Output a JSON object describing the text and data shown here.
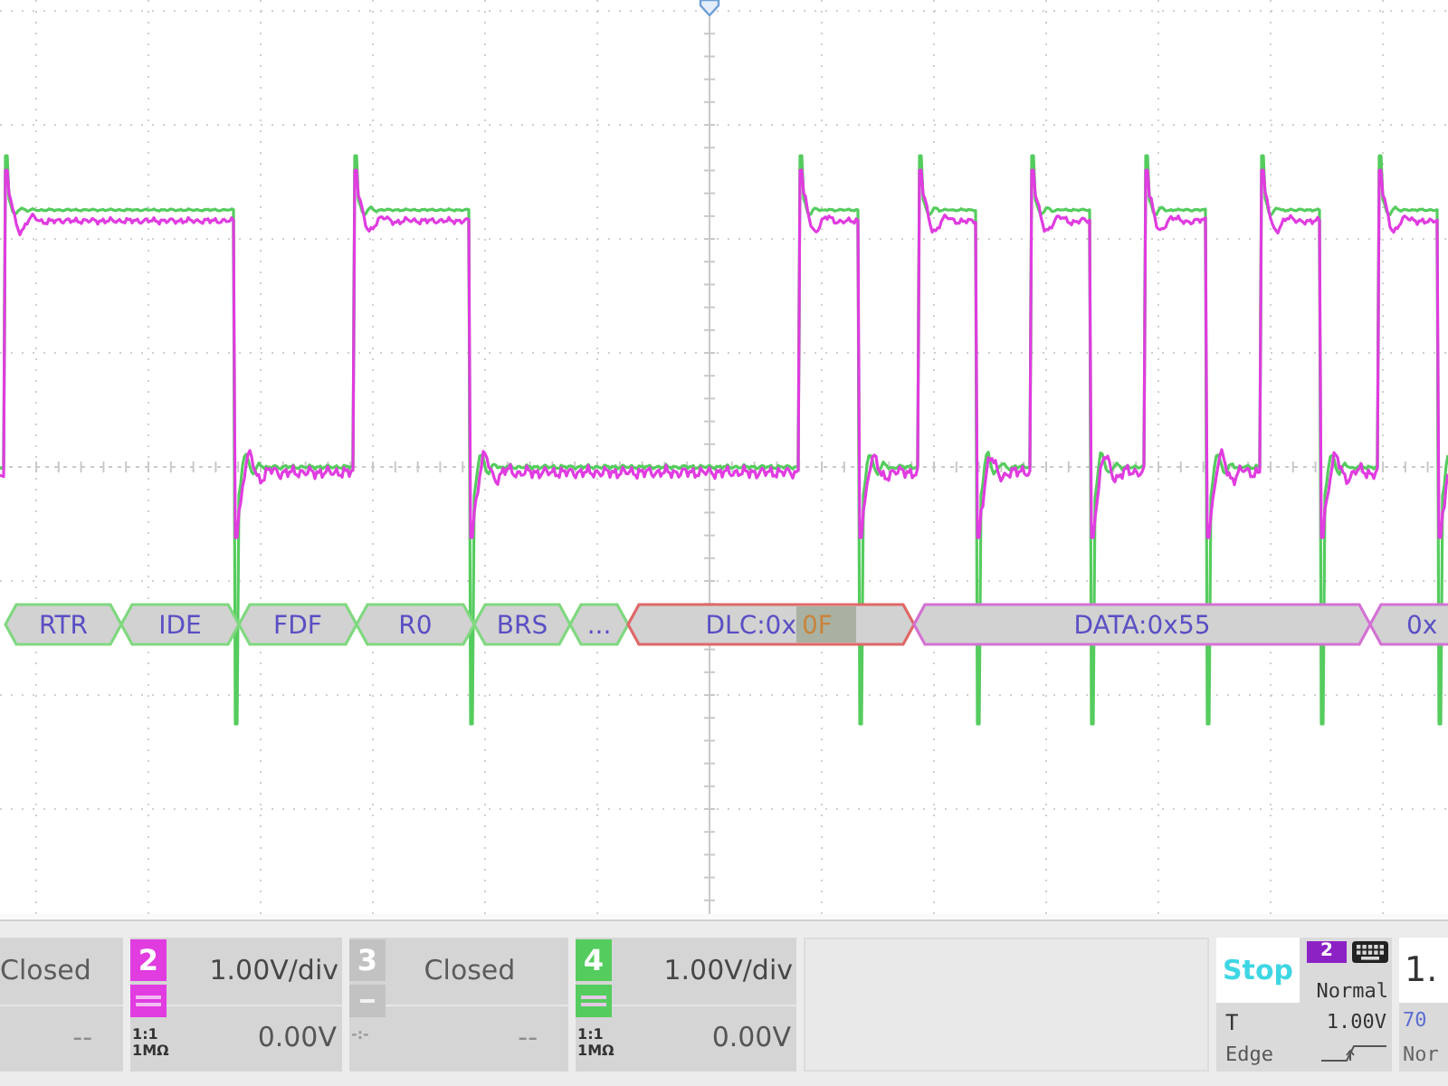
{
  "decode_bus": {
    "segments": [
      {
        "kind": "control",
        "label": "RTR"
      },
      {
        "kind": "control",
        "label": "IDE"
      },
      {
        "kind": "control",
        "label": "FDF"
      },
      {
        "kind": "control",
        "label": "R0"
      },
      {
        "kind": "control",
        "label": "BRS"
      },
      {
        "kind": "control",
        "label": "..."
      },
      {
        "kind": "length",
        "label": "DLC:0x",
        "marked": "0F"
      },
      {
        "kind": "data",
        "label": "DATA:0x55"
      },
      {
        "kind": "data",
        "label": "0x"
      }
    ]
  },
  "channels": [
    {
      "kind": "closed",
      "status": "Closed",
      "offset": "--"
    },
    {
      "kind": "open",
      "number": "2",
      "color": "#e03ce0",
      "scale": "1.00V/div",
      "offset": "0.00V",
      "probe": "1:1",
      "impedance": "1MΩ"
    },
    {
      "kind": "closed",
      "number": "3",
      "color": "#c2c2c2",
      "status": "Closed",
      "offset": "--",
      "probe": "-:-"
    },
    {
      "kind": "open",
      "number": "4",
      "color": "#55cc5e",
      "scale": "1.00V/div",
      "offset": "0.00V",
      "probe": "1:1",
      "impedance": "1MΩ"
    }
  ],
  "trigger": {
    "run_state": "Stop",
    "source": "2",
    "mode": "Normal",
    "label": "T",
    "threshold": "1.00V",
    "type": "Edge",
    "slope": {
      "kind": "rising"
    }
  },
  "timebase": {
    "scale": "1.",
    "delay": "70",
    "mode": "Nor"
  }
}
